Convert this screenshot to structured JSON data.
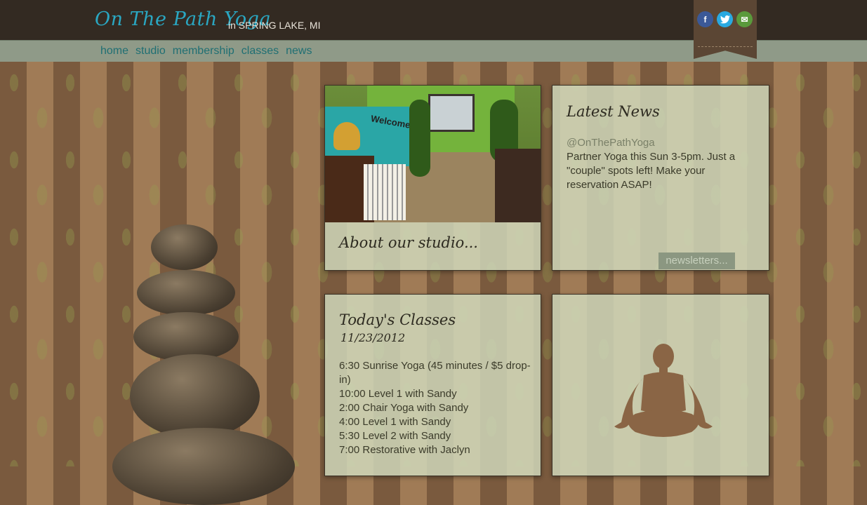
{
  "header": {
    "brand": "On The Path Yoga",
    "location": "in SPRING LAKE, MI"
  },
  "nav": {
    "items": [
      "home",
      "studio",
      "membership",
      "classes",
      "news"
    ]
  },
  "social": {
    "facebook": "f",
    "email_glyph": "✉"
  },
  "studio_card": {
    "photo_sign": "Welcome",
    "title": "About our studio..."
  },
  "news_card": {
    "title": "Latest News",
    "handle": "@OnThePathYoga",
    "body": "Partner Yoga this Sun 3-5pm. Just a \"couple\" spots left! Make your reservation ASAP!",
    "newsletters_button": "newsletters..."
  },
  "classes_card": {
    "title": "Today's Classes",
    "date": "11/23/2012",
    "items": [
      "6:30 Sunrise Yoga (45 minutes / $5 drop-in)",
      "10:00 Level 1 with Sandy",
      "2:00 Chair Yoga with Sandy",
      "4:00 Level 1 with Sandy",
      "5:30 Level 2 with Sandy",
      "7:00 Restorative with Jaclyn"
    ]
  },
  "colors": {
    "brand": "#2aa7c2",
    "topbar": "#332a22",
    "navbar": "#8f9a88"
  }
}
